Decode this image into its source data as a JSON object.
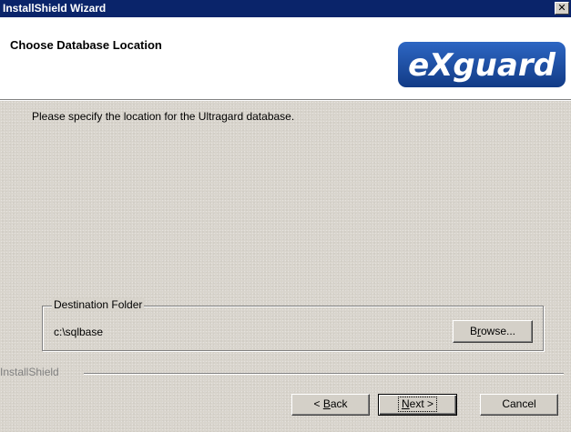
{
  "window": {
    "title": "InstallShield Wizard",
    "close_glyph": "✕"
  },
  "header": {
    "heading": "Choose Database Location",
    "logo_text": "eXguard",
    "logo_color": "#1a4fa0"
  },
  "body": {
    "instruction": "Please specify the location for the Ultragard database.",
    "destination": {
      "legend": "Destination Folder",
      "path": "c:\\sqlbase",
      "browse_label_pre": "B",
      "browse_label_accel": "r",
      "browse_label_post": "owse..."
    },
    "footer_brand": "InstallShield"
  },
  "buttons": {
    "back": {
      "pre": "< ",
      "accel": "B",
      "post": "ack"
    },
    "next": {
      "accel": "N",
      "post": "ext >"
    },
    "cancel": "Cancel"
  }
}
